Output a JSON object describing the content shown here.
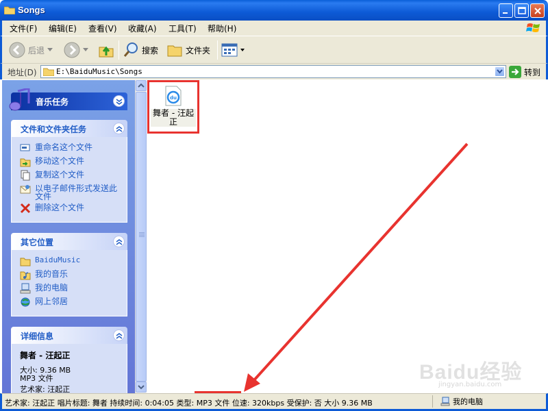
{
  "window": {
    "title": "Songs"
  },
  "menu": [
    "文件(F)",
    "编辑(E)",
    "查看(V)",
    "收藏(A)",
    "工具(T)",
    "帮助(H)"
  ],
  "toolbar": {
    "back": "后退",
    "search": "搜索",
    "folders": "文件夹"
  },
  "address": {
    "label": "地址(D)",
    "path": "E:\\BaiduMusic\\Songs",
    "go": "转到"
  },
  "panel": {
    "music_tasks": {
      "title": "音乐任务"
    },
    "file_tasks": {
      "title": "文件和文件夹任务",
      "items": [
        "重命名这个文件",
        "移动这个文件",
        "复制这个文件",
        "以电子邮件形式发送此文件",
        "删除这个文件"
      ]
    },
    "other_places": {
      "title": "其它位置",
      "items": [
        "BaiduMusic",
        "我的音乐",
        "我的电脑",
        "网上邻居"
      ]
    },
    "details": {
      "title": "详细信息",
      "name": "舞者 - 汪起正",
      "size": "大小: 9.36 MB",
      "type": "MP3 文件",
      "artist": "艺术家: 汪起正"
    }
  },
  "file": {
    "name": "舞者 - 汪起正"
  },
  "status": {
    "text": "艺术家: 汪起正 唱片标题: 舞者 持续时间: 0:04:05 类型: MP3 文件 位速: 320kbps 受保护: 否 大小 9.36 MB",
    "location": "我的电脑"
  },
  "watermark": {
    "main": "Baidu经验",
    "sub": "jingyan.baidu.com"
  },
  "colors": {
    "title_bar": "#0d5ad6",
    "panel_link": "#215dc6",
    "highlight": "#e8332f"
  }
}
